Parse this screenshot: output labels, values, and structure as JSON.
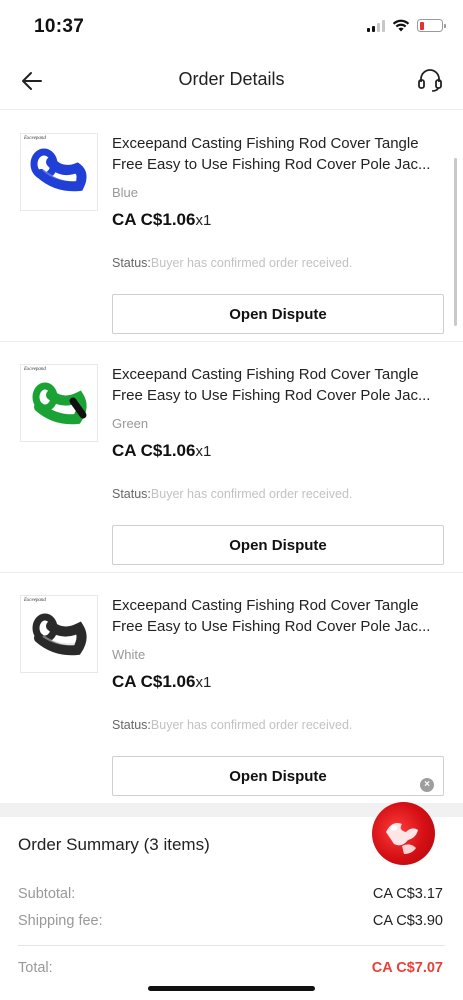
{
  "status_bar": {
    "time": "10:37"
  },
  "nav": {
    "title": "Order Details",
    "back_icon": "arrow-left-icon",
    "support_icon": "headset-icon"
  },
  "items": [
    {
      "brand": "Exceepand",
      "title": "Exceepand Casting Fishing Rod Cover Tangle Free Easy to Use Fishing Rod Cover Pole Jac...",
      "variant": "Blue",
      "price": "CA C$1.06",
      "qty": "x1",
      "status_label": "Status:",
      "status_value": "Buyer has confirmed order received.",
      "button": "Open Dispute",
      "color": "#1f3fd6"
    },
    {
      "brand": "Exceepand",
      "title": "Exceepand Casting Fishing Rod Cover Tangle Free Easy to Use Fishing Rod Cover Pole Jac...",
      "variant": "Green",
      "price": "CA C$1.06",
      "qty": "x1",
      "status_label": "Status:",
      "status_value": "Buyer has confirmed order received.",
      "button": "Open Dispute",
      "color": "#1aa334"
    },
    {
      "brand": "Exceepand",
      "title": "Exceepand Casting Fishing Rod Cover Tangle Free Easy to Use Fishing Rod Cover Pole Jac...",
      "variant": "White",
      "price": "CA C$1.06",
      "qty": "x1",
      "status_label": "Status:",
      "status_value": "Buyer has confirmed order received.",
      "button": "Open Dispute",
      "color": "#2a2a2a"
    }
  ],
  "summary": {
    "title": "Order Summary (3 items)",
    "subtotal_label": "Subtotal:",
    "subtotal_value": "CA C$3.17",
    "shipping_label": "Shipping fee:",
    "shipping_value": "CA C$3.90",
    "total_label": "Total:",
    "total_value": "CA C$7.07"
  },
  "colors": {
    "total_accent": "#e8413a",
    "float_chat": "#d40f14"
  }
}
